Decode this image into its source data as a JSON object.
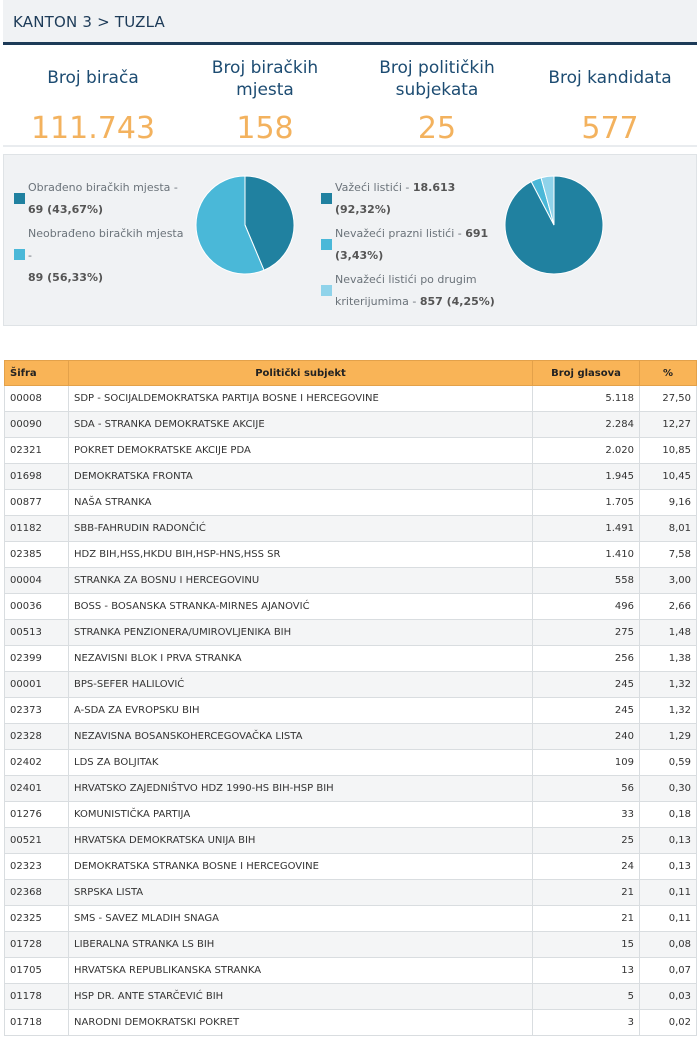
{
  "header": {
    "breadcrumb": "KANTON 3 > TUZLA"
  },
  "stats": [
    {
      "label_lines": [
        "Broj birača"
      ],
      "value": "111.743"
    },
    {
      "label_lines": [
        "Broj biračkih",
        "mjesta"
      ],
      "value": "158"
    },
    {
      "label_lines": [
        "Broj političkih",
        "subjekata"
      ],
      "value": "25"
    },
    {
      "label_lines": [
        "Broj kandidata"
      ],
      "value": "577"
    }
  ],
  "colors": {
    "accent_orange": "#f3b25e",
    "table_header": "#f9b457",
    "navy": "#1d3b58",
    "pie_dark": "#2081a0",
    "pie_light": "#4ab8d8",
    "pie_pale": "#8fd3ea"
  },
  "stations": {
    "legend": [
      {
        "line1": "Obrađeno biračkih mjesta -",
        "line2_value": "69 (43,67%)",
        "color": "#2081a0"
      },
      {
        "line1": "Neobrađeno biračkih mjesta -",
        "line2_value": "89 (56,33%)",
        "color": "#4ab8d8"
      }
    ],
    "pie_values": [
      43.67,
      56.33
    ]
  },
  "ballots": {
    "legend": [
      {
        "line1": "Važeći listići - ",
        "line1_value": "18.613",
        "line2_value": "(92,32%)",
        "color": "#2081a0"
      },
      {
        "line1": "Nevažeći prazni listići - ",
        "line1_value": "691",
        "line2_value": "(3,43%)",
        "color": "#4ab8d8"
      },
      {
        "line1": "Nevažeći listići po drugim",
        "line2": "kriterijumima - ",
        "line2_value": "857 (4,25%)",
        "color": "#8fd3ea"
      }
    ],
    "pie_values": [
      92.32,
      3.43,
      4.25
    ]
  },
  "table": {
    "headers": {
      "code": "Šifra",
      "party": "Politički subjekt",
      "votes": "Broj glasova",
      "pct": "%"
    },
    "rows": [
      {
        "code": "00008",
        "party": "SDP - SOCIJALDEMOKRATSKA PARTIJA BOSNE I HERCEGOVINE",
        "votes": "5.118",
        "pct": "27,50"
      },
      {
        "code": "00090",
        "party": "SDA - STRANKA DEMOKRATSKE AKCIJE",
        "votes": "2.284",
        "pct": "12,27"
      },
      {
        "code": "02321",
        "party": "POKRET DEMOKRATSKE AKCIJE PDA",
        "votes": "2.020",
        "pct": "10,85"
      },
      {
        "code": "01698",
        "party": "DEMOKRATSKA FRONTA",
        "votes": "1.945",
        "pct": "10,45"
      },
      {
        "code": "00877",
        "party": "NAŠA STRANKA",
        "votes": "1.705",
        "pct": "9,16"
      },
      {
        "code": "01182",
        "party": "SBB-FAHRUDIN RADONČIĆ",
        "votes": "1.491",
        "pct": "8,01"
      },
      {
        "code": "02385",
        "party": "HDZ BIH,HSS,HKDU BIH,HSP-HNS,HSS SR",
        "votes": "1.410",
        "pct": "7,58"
      },
      {
        "code": "00004",
        "party": "STRANKA ZA BOSNU I HERCEGOVINU",
        "votes": "558",
        "pct": "3,00"
      },
      {
        "code": "00036",
        "party": "BOSS - BOSANSKA STRANKA-MIRNES AJANOVIĆ",
        "votes": "496",
        "pct": "2,66"
      },
      {
        "code": "00513",
        "party": "STRANKA PENZIONERA/UMIROVLJENIKA BIH",
        "votes": "275",
        "pct": "1,48"
      },
      {
        "code": "02399",
        "party": "NEZAVISNI BLOK I PRVA STRANKA",
        "votes": "256",
        "pct": "1,38"
      },
      {
        "code": "00001",
        "party": "BPS-SEFER HALILOVIĆ",
        "votes": "245",
        "pct": "1,32"
      },
      {
        "code": "02373",
        "party": "A-SDA ZA EVROPSKU BIH",
        "votes": "245",
        "pct": "1,32"
      },
      {
        "code": "02328",
        "party": "NEZAVISNA BOSANSKOHERCEGOVAČKA LISTA",
        "votes": "240",
        "pct": "1,29"
      },
      {
        "code": "02402",
        "party": "LDS ZA BOLJITAK",
        "votes": "109",
        "pct": "0,59"
      },
      {
        "code": "02401",
        "party": "HRVATSKO ZAJEDNIŠTVO HDZ 1990-HS BIH-HSP BIH",
        "votes": "56",
        "pct": "0,30"
      },
      {
        "code": "01276",
        "party": "KOMUNISTIČKA PARTIJA",
        "votes": "33",
        "pct": "0,18"
      },
      {
        "code": "00521",
        "party": "HRVATSKA DEMOKRATSKA UNIJA BIH",
        "votes": "25",
        "pct": "0,13"
      },
      {
        "code": "02323",
        "party": "DEMOKRATSKA STRANKA BOSNE I HERCEGOVINE",
        "votes": "24",
        "pct": "0,13"
      },
      {
        "code": "02368",
        "party": "SRPSKA LISTA",
        "votes": "21",
        "pct": "0,11"
      },
      {
        "code": "02325",
        "party": "SMS - SAVEZ MLADIH SNAGA",
        "votes": "21",
        "pct": "0,11"
      },
      {
        "code": "01728",
        "party": "LIBERALNA STRANKA LS BIH",
        "votes": "15",
        "pct": "0,08"
      },
      {
        "code": "01705",
        "party": "HRVATSKA REPUBLIKANSKA STRANKA",
        "votes": "13",
        "pct": "0,07"
      },
      {
        "code": "01178",
        "party": "HSP DR. ANTE STARČEVIĆ BIH",
        "votes": "5",
        "pct": "0,03"
      },
      {
        "code": "01718",
        "party": "NARODNI DEMOKRATSKI POKRET",
        "votes": "3",
        "pct": "0,02"
      }
    ]
  }
}
